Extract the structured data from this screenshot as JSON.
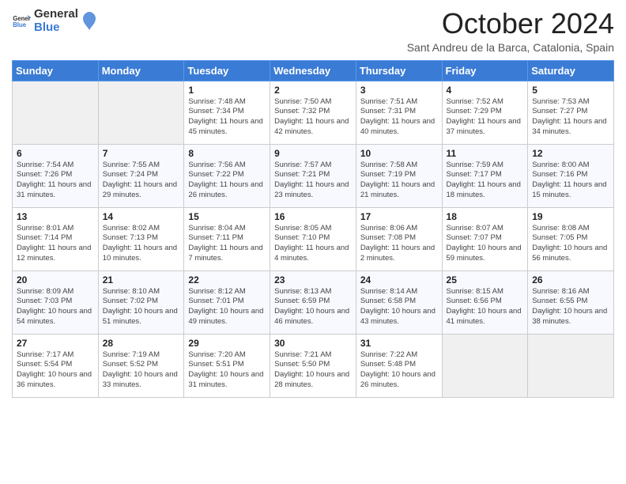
{
  "logo": {
    "general": "General",
    "blue": "Blue"
  },
  "header": {
    "month_year": "October 2024",
    "location": "Sant Andreu de la Barca, Catalonia, Spain"
  },
  "weekdays": [
    "Sunday",
    "Monday",
    "Tuesday",
    "Wednesday",
    "Thursday",
    "Friday",
    "Saturday"
  ],
  "weeks": [
    [
      {
        "day": "",
        "sunrise": "",
        "sunset": "",
        "daylight": ""
      },
      {
        "day": "",
        "sunrise": "",
        "sunset": "",
        "daylight": ""
      },
      {
        "day": "1",
        "sunrise": "Sunrise: 7:48 AM",
        "sunset": "Sunset: 7:34 PM",
        "daylight": "Daylight: 11 hours and 45 minutes."
      },
      {
        "day": "2",
        "sunrise": "Sunrise: 7:50 AM",
        "sunset": "Sunset: 7:32 PM",
        "daylight": "Daylight: 11 hours and 42 minutes."
      },
      {
        "day": "3",
        "sunrise": "Sunrise: 7:51 AM",
        "sunset": "Sunset: 7:31 PM",
        "daylight": "Daylight: 11 hours and 40 minutes."
      },
      {
        "day": "4",
        "sunrise": "Sunrise: 7:52 AM",
        "sunset": "Sunset: 7:29 PM",
        "daylight": "Daylight: 11 hours and 37 minutes."
      },
      {
        "day": "5",
        "sunrise": "Sunrise: 7:53 AM",
        "sunset": "Sunset: 7:27 PM",
        "daylight": "Daylight: 11 hours and 34 minutes."
      }
    ],
    [
      {
        "day": "6",
        "sunrise": "Sunrise: 7:54 AM",
        "sunset": "Sunset: 7:26 PM",
        "daylight": "Daylight: 11 hours and 31 minutes."
      },
      {
        "day": "7",
        "sunrise": "Sunrise: 7:55 AM",
        "sunset": "Sunset: 7:24 PM",
        "daylight": "Daylight: 11 hours and 29 minutes."
      },
      {
        "day": "8",
        "sunrise": "Sunrise: 7:56 AM",
        "sunset": "Sunset: 7:22 PM",
        "daylight": "Daylight: 11 hours and 26 minutes."
      },
      {
        "day": "9",
        "sunrise": "Sunrise: 7:57 AM",
        "sunset": "Sunset: 7:21 PM",
        "daylight": "Daylight: 11 hours and 23 minutes."
      },
      {
        "day": "10",
        "sunrise": "Sunrise: 7:58 AM",
        "sunset": "Sunset: 7:19 PM",
        "daylight": "Daylight: 11 hours and 21 minutes."
      },
      {
        "day": "11",
        "sunrise": "Sunrise: 7:59 AM",
        "sunset": "Sunset: 7:17 PM",
        "daylight": "Daylight: 11 hours and 18 minutes."
      },
      {
        "day": "12",
        "sunrise": "Sunrise: 8:00 AM",
        "sunset": "Sunset: 7:16 PM",
        "daylight": "Daylight: 11 hours and 15 minutes."
      }
    ],
    [
      {
        "day": "13",
        "sunrise": "Sunrise: 8:01 AM",
        "sunset": "Sunset: 7:14 PM",
        "daylight": "Daylight: 11 hours and 12 minutes."
      },
      {
        "day": "14",
        "sunrise": "Sunrise: 8:02 AM",
        "sunset": "Sunset: 7:13 PM",
        "daylight": "Daylight: 11 hours and 10 minutes."
      },
      {
        "day": "15",
        "sunrise": "Sunrise: 8:04 AM",
        "sunset": "Sunset: 7:11 PM",
        "daylight": "Daylight: 11 hours and 7 minutes."
      },
      {
        "day": "16",
        "sunrise": "Sunrise: 8:05 AM",
        "sunset": "Sunset: 7:10 PM",
        "daylight": "Daylight: 11 hours and 4 minutes."
      },
      {
        "day": "17",
        "sunrise": "Sunrise: 8:06 AM",
        "sunset": "Sunset: 7:08 PM",
        "daylight": "Daylight: 11 hours and 2 minutes."
      },
      {
        "day": "18",
        "sunrise": "Sunrise: 8:07 AM",
        "sunset": "Sunset: 7:07 PM",
        "daylight": "Daylight: 10 hours and 59 minutes."
      },
      {
        "day": "19",
        "sunrise": "Sunrise: 8:08 AM",
        "sunset": "Sunset: 7:05 PM",
        "daylight": "Daylight: 10 hours and 56 minutes."
      }
    ],
    [
      {
        "day": "20",
        "sunrise": "Sunrise: 8:09 AM",
        "sunset": "Sunset: 7:03 PM",
        "daylight": "Daylight: 10 hours and 54 minutes."
      },
      {
        "day": "21",
        "sunrise": "Sunrise: 8:10 AM",
        "sunset": "Sunset: 7:02 PM",
        "daylight": "Daylight: 10 hours and 51 minutes."
      },
      {
        "day": "22",
        "sunrise": "Sunrise: 8:12 AM",
        "sunset": "Sunset: 7:01 PM",
        "daylight": "Daylight: 10 hours and 49 minutes."
      },
      {
        "day": "23",
        "sunrise": "Sunrise: 8:13 AM",
        "sunset": "Sunset: 6:59 PM",
        "daylight": "Daylight: 10 hours and 46 minutes."
      },
      {
        "day": "24",
        "sunrise": "Sunrise: 8:14 AM",
        "sunset": "Sunset: 6:58 PM",
        "daylight": "Daylight: 10 hours and 43 minutes."
      },
      {
        "day": "25",
        "sunrise": "Sunrise: 8:15 AM",
        "sunset": "Sunset: 6:56 PM",
        "daylight": "Daylight: 10 hours and 41 minutes."
      },
      {
        "day": "26",
        "sunrise": "Sunrise: 8:16 AM",
        "sunset": "Sunset: 6:55 PM",
        "daylight": "Daylight: 10 hours and 38 minutes."
      }
    ],
    [
      {
        "day": "27",
        "sunrise": "Sunrise: 7:17 AM",
        "sunset": "Sunset: 5:54 PM",
        "daylight": "Daylight: 10 hours and 36 minutes."
      },
      {
        "day": "28",
        "sunrise": "Sunrise: 7:19 AM",
        "sunset": "Sunset: 5:52 PM",
        "daylight": "Daylight: 10 hours and 33 minutes."
      },
      {
        "day": "29",
        "sunrise": "Sunrise: 7:20 AM",
        "sunset": "Sunset: 5:51 PM",
        "daylight": "Daylight: 10 hours and 31 minutes."
      },
      {
        "day": "30",
        "sunrise": "Sunrise: 7:21 AM",
        "sunset": "Sunset: 5:50 PM",
        "daylight": "Daylight: 10 hours and 28 minutes."
      },
      {
        "day": "31",
        "sunrise": "Sunrise: 7:22 AM",
        "sunset": "Sunset: 5:48 PM",
        "daylight": "Daylight: 10 hours and 26 minutes."
      },
      {
        "day": "",
        "sunrise": "",
        "sunset": "",
        "daylight": ""
      },
      {
        "day": "",
        "sunrise": "",
        "sunset": "",
        "daylight": ""
      }
    ]
  ]
}
